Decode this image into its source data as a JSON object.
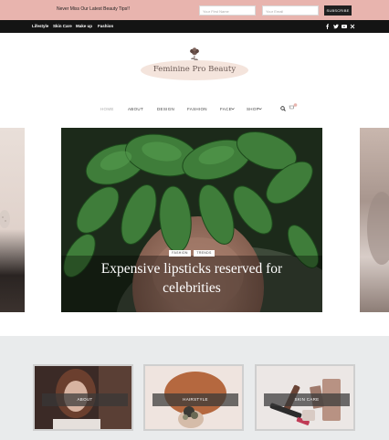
{
  "newsletter": {
    "text": "Never Miss Our Latest Beauty Tips!!",
    "first_name_placeholder": "Your First Name",
    "email_placeholder": "Your Email",
    "subscribe_label": "SUBSCRIBE"
  },
  "topnav": {
    "categories": [
      "Lifestyle",
      "Skin Care",
      "Make up",
      "Fashion"
    ],
    "social": [
      "facebook-icon",
      "twitter-icon",
      "youtube-icon",
      "x-icon"
    ]
  },
  "logo": {
    "text": "Feminine Pro Beauty"
  },
  "menu": {
    "items": [
      "HOME",
      "ABOUT",
      "DESIGN",
      "FASHION",
      "FACE",
      "SHOP"
    ],
    "active_index": 0
  },
  "hero": {
    "tags": [
      "FASHION",
      "TRENDS"
    ],
    "title": "Expensive lipsticks reserved for celebrities"
  },
  "cards": [
    {
      "label": "ABOUT"
    },
    {
      "label": "HAIRSTYLE"
    },
    {
      "label": "SKIN CARE"
    }
  ],
  "colors": {
    "newsletter_bg": "#e8b4ae",
    "topnav_bg": "#141414",
    "band_bg": "#e9ebec"
  }
}
